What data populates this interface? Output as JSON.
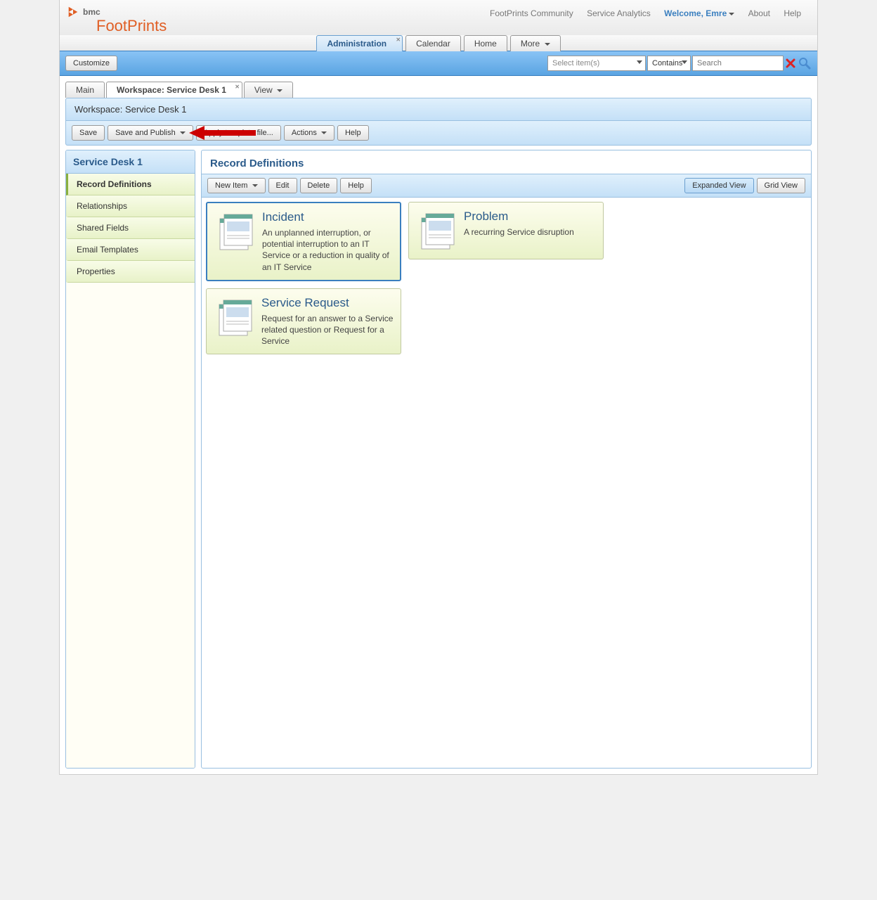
{
  "header": {
    "logo_bmc": "bmc",
    "logo_product": "FootPrints",
    "links": {
      "community": "FootPrints Community",
      "analytics": "Service Analytics",
      "welcome": "Welcome, Emre",
      "about": "About",
      "help": "Help"
    }
  },
  "nav_tabs": {
    "administration": "Administration",
    "calendar": "Calendar",
    "home": "Home",
    "more": "More"
  },
  "blue_bar": {
    "customize": "Customize",
    "select_items_placeholder": "Select item(s)",
    "contains": "Contains",
    "search_placeholder": "Search"
  },
  "inner_tabs": {
    "main": "Main",
    "workspace": "Workspace: Service Desk 1",
    "view": "View"
  },
  "workspace_header": "Workspace: Service Desk 1",
  "toolbar": {
    "save": "Save",
    "save_publish": "Save and Publish",
    "apply_template": "Apply template file...",
    "actions": "Actions",
    "help": "Help"
  },
  "sidebar": {
    "title": "Service Desk 1",
    "items": {
      "record_definitions": "Record Definitions",
      "relationships": "Relationships",
      "shared_fields": "Shared Fields",
      "email_templates": "Email Templates",
      "properties": "Properties"
    }
  },
  "panel": {
    "title": "Record Definitions",
    "toolbar": {
      "new_item": "New Item",
      "edit": "Edit",
      "delete": "Delete",
      "help": "Help",
      "expanded_view": "Expanded View",
      "grid_view": "Grid View"
    }
  },
  "cards": {
    "incident": {
      "title": "Incident",
      "desc": "An unplanned interruption, or potential interruption to an IT Service or a reduction in quality of an IT Service"
    },
    "service_request": {
      "title": "Service Request",
      "desc": "Request for an answer to a Service related question or Request for a Service"
    },
    "problem": {
      "title": "Problem",
      "desc": "A recurring Service disruption"
    }
  }
}
